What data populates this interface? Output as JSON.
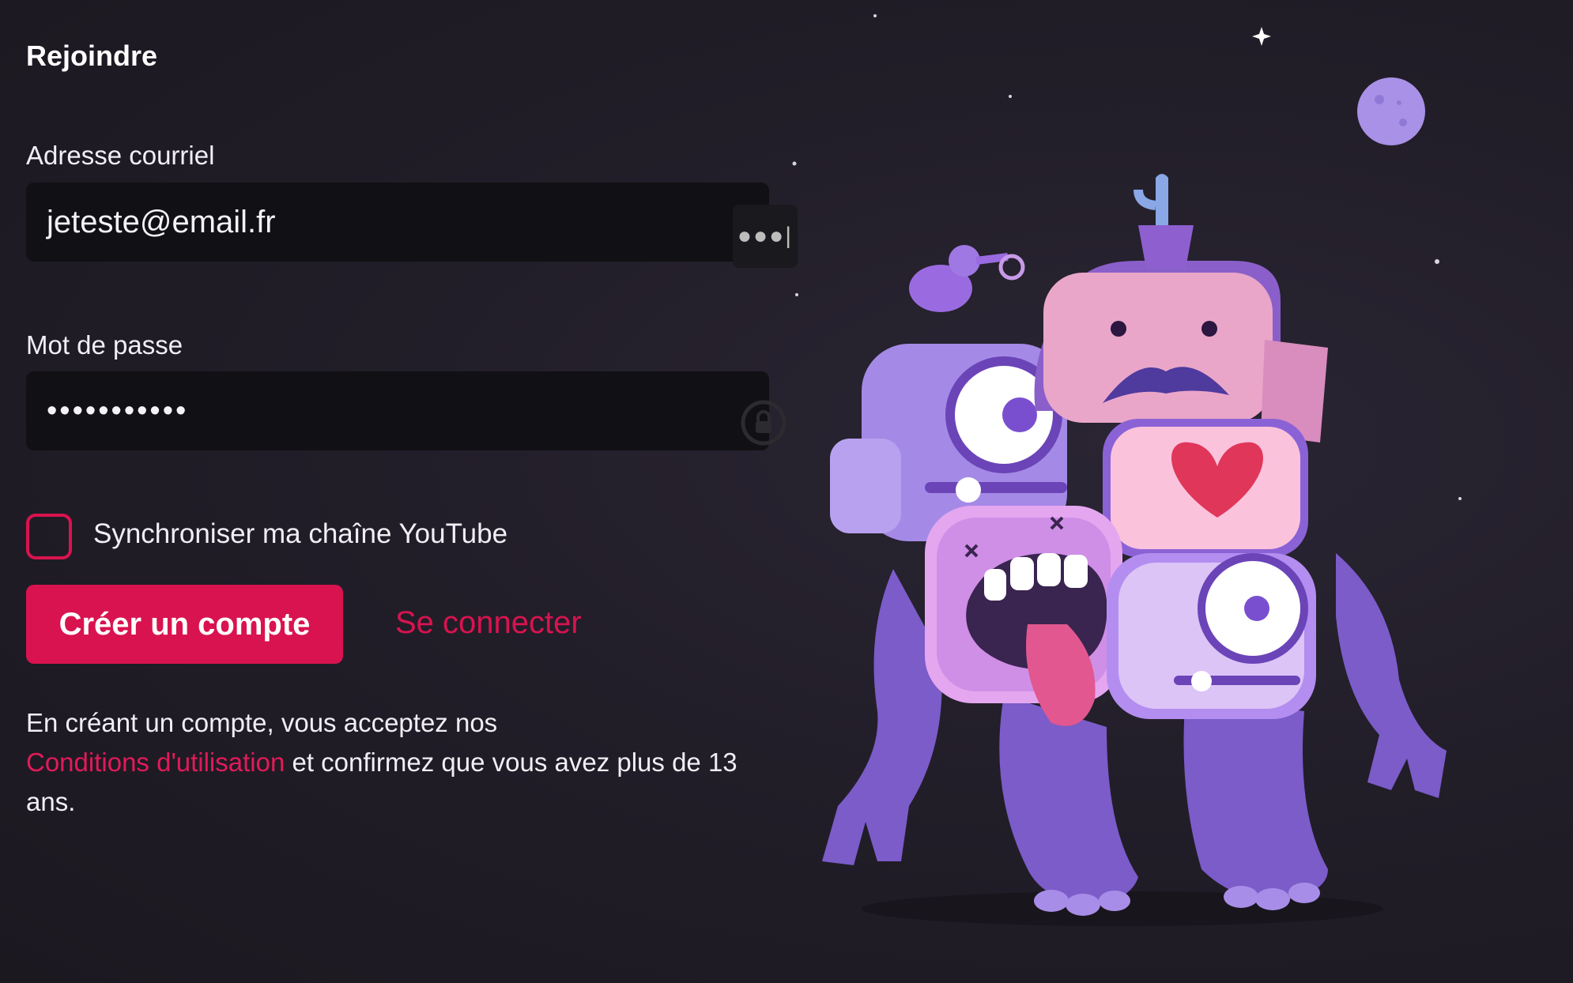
{
  "title": "Rejoindre",
  "email": {
    "label": "Adresse courriel",
    "value": "jeteste@email.fr",
    "manager_glyph": "●●●|"
  },
  "password": {
    "label": "Mot de passe",
    "value": "•••••••••••"
  },
  "sync": {
    "label": "Synchroniser ma chaîne YouTube",
    "checked": false
  },
  "actions": {
    "create_account": "Créer un compte",
    "login": "Se connecter"
  },
  "terms": {
    "prefix": "En créant un compte, vous acceptez nos",
    "link": "Conditions d'utilisation",
    "suffix": " et confirmez que vous avez plus de 13 ans."
  },
  "colors": {
    "accent": "#d9134f",
    "background": "#1e1b24",
    "input_background": "#111014"
  },
  "icons": [
    "password-manager-icon",
    "lock-icon",
    "moon-icon",
    "star-icon",
    "heart-icon"
  ]
}
